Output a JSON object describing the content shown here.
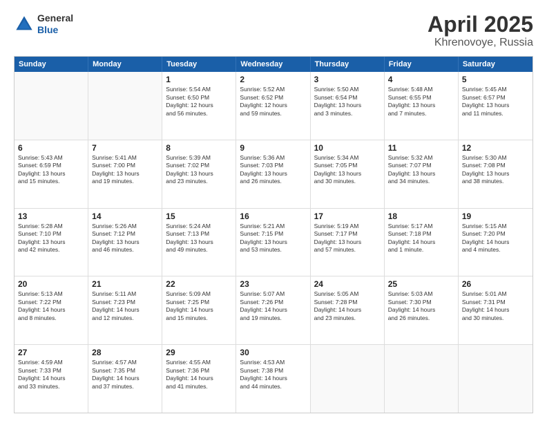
{
  "header": {
    "logo_general": "General",
    "logo_blue": "Blue",
    "title": "April 2025",
    "subtitle": "Khrenovoye, Russia"
  },
  "weekdays": [
    "Sunday",
    "Monday",
    "Tuesday",
    "Wednesday",
    "Thursday",
    "Friday",
    "Saturday"
  ],
  "rows": [
    [
      {
        "day": "",
        "text": ""
      },
      {
        "day": "",
        "text": ""
      },
      {
        "day": "1",
        "text": "Sunrise: 5:54 AM\nSunset: 6:50 PM\nDaylight: 12 hours\nand 56 minutes."
      },
      {
        "day": "2",
        "text": "Sunrise: 5:52 AM\nSunset: 6:52 PM\nDaylight: 12 hours\nand 59 minutes."
      },
      {
        "day": "3",
        "text": "Sunrise: 5:50 AM\nSunset: 6:54 PM\nDaylight: 13 hours\nand 3 minutes."
      },
      {
        "day": "4",
        "text": "Sunrise: 5:48 AM\nSunset: 6:55 PM\nDaylight: 13 hours\nand 7 minutes."
      },
      {
        "day": "5",
        "text": "Sunrise: 5:45 AM\nSunset: 6:57 PM\nDaylight: 13 hours\nand 11 minutes."
      }
    ],
    [
      {
        "day": "6",
        "text": "Sunrise: 5:43 AM\nSunset: 6:59 PM\nDaylight: 13 hours\nand 15 minutes."
      },
      {
        "day": "7",
        "text": "Sunrise: 5:41 AM\nSunset: 7:00 PM\nDaylight: 13 hours\nand 19 minutes."
      },
      {
        "day": "8",
        "text": "Sunrise: 5:39 AM\nSunset: 7:02 PM\nDaylight: 13 hours\nand 23 minutes."
      },
      {
        "day": "9",
        "text": "Sunrise: 5:36 AM\nSunset: 7:03 PM\nDaylight: 13 hours\nand 26 minutes."
      },
      {
        "day": "10",
        "text": "Sunrise: 5:34 AM\nSunset: 7:05 PM\nDaylight: 13 hours\nand 30 minutes."
      },
      {
        "day": "11",
        "text": "Sunrise: 5:32 AM\nSunset: 7:07 PM\nDaylight: 13 hours\nand 34 minutes."
      },
      {
        "day": "12",
        "text": "Sunrise: 5:30 AM\nSunset: 7:08 PM\nDaylight: 13 hours\nand 38 minutes."
      }
    ],
    [
      {
        "day": "13",
        "text": "Sunrise: 5:28 AM\nSunset: 7:10 PM\nDaylight: 13 hours\nand 42 minutes."
      },
      {
        "day": "14",
        "text": "Sunrise: 5:26 AM\nSunset: 7:12 PM\nDaylight: 13 hours\nand 46 minutes."
      },
      {
        "day": "15",
        "text": "Sunrise: 5:24 AM\nSunset: 7:13 PM\nDaylight: 13 hours\nand 49 minutes."
      },
      {
        "day": "16",
        "text": "Sunrise: 5:21 AM\nSunset: 7:15 PM\nDaylight: 13 hours\nand 53 minutes."
      },
      {
        "day": "17",
        "text": "Sunrise: 5:19 AM\nSunset: 7:17 PM\nDaylight: 13 hours\nand 57 minutes."
      },
      {
        "day": "18",
        "text": "Sunrise: 5:17 AM\nSunset: 7:18 PM\nDaylight: 14 hours\nand 1 minute."
      },
      {
        "day": "19",
        "text": "Sunrise: 5:15 AM\nSunset: 7:20 PM\nDaylight: 14 hours\nand 4 minutes."
      }
    ],
    [
      {
        "day": "20",
        "text": "Sunrise: 5:13 AM\nSunset: 7:22 PM\nDaylight: 14 hours\nand 8 minutes."
      },
      {
        "day": "21",
        "text": "Sunrise: 5:11 AM\nSunset: 7:23 PM\nDaylight: 14 hours\nand 12 minutes."
      },
      {
        "day": "22",
        "text": "Sunrise: 5:09 AM\nSunset: 7:25 PM\nDaylight: 14 hours\nand 15 minutes."
      },
      {
        "day": "23",
        "text": "Sunrise: 5:07 AM\nSunset: 7:26 PM\nDaylight: 14 hours\nand 19 minutes."
      },
      {
        "day": "24",
        "text": "Sunrise: 5:05 AM\nSunset: 7:28 PM\nDaylight: 14 hours\nand 23 minutes."
      },
      {
        "day": "25",
        "text": "Sunrise: 5:03 AM\nSunset: 7:30 PM\nDaylight: 14 hours\nand 26 minutes."
      },
      {
        "day": "26",
        "text": "Sunrise: 5:01 AM\nSunset: 7:31 PM\nDaylight: 14 hours\nand 30 minutes."
      }
    ],
    [
      {
        "day": "27",
        "text": "Sunrise: 4:59 AM\nSunset: 7:33 PM\nDaylight: 14 hours\nand 33 minutes."
      },
      {
        "day": "28",
        "text": "Sunrise: 4:57 AM\nSunset: 7:35 PM\nDaylight: 14 hours\nand 37 minutes."
      },
      {
        "day": "29",
        "text": "Sunrise: 4:55 AM\nSunset: 7:36 PM\nDaylight: 14 hours\nand 41 minutes."
      },
      {
        "day": "30",
        "text": "Sunrise: 4:53 AM\nSunset: 7:38 PM\nDaylight: 14 hours\nand 44 minutes."
      },
      {
        "day": "",
        "text": ""
      },
      {
        "day": "",
        "text": ""
      },
      {
        "day": "",
        "text": ""
      }
    ]
  ]
}
